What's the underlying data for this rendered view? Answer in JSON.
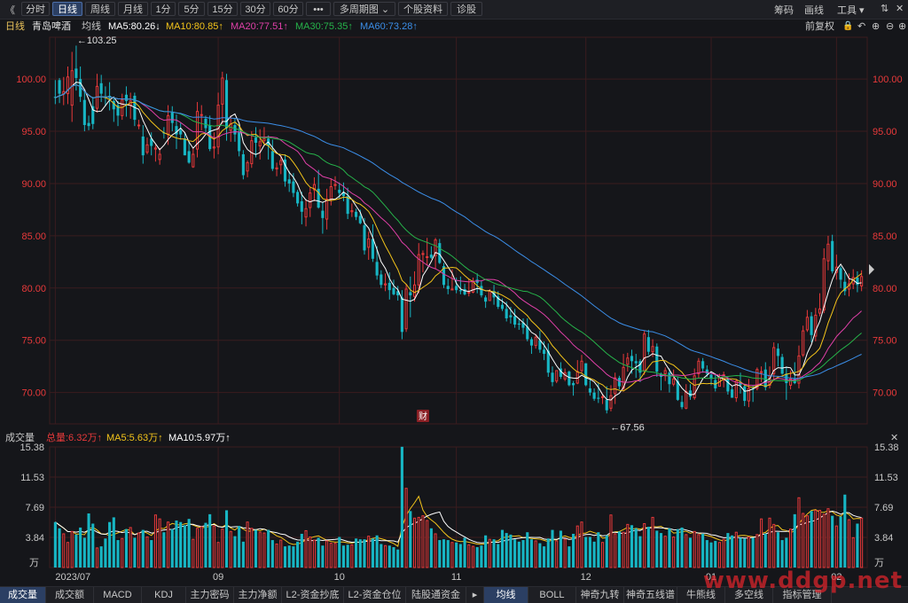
{
  "toolbar": {
    "back_icon": "double-chevron-left-icon",
    "back_glyph": "《",
    "periods": [
      "分时",
      "日线",
      "周线",
      "月线",
      "1分",
      "5分",
      "15分",
      "30分",
      "60分",
      "•••",
      "多周期图 ⌄",
      "个股资料",
      "诊股"
    ],
    "active_period": "日线",
    "right_items": [
      "筹码",
      "画线",
      "工具 ▾"
    ],
    "window_glyphs": [
      "⇅",
      "✕"
    ]
  },
  "legend": {
    "period": "日线",
    "stock": "青岛啤酒",
    "avg": "均线",
    "ma5": "MA5:80.26↓",
    "ma10": "MA10:80.85↑",
    "ma20": "MA20:77.51↑",
    "ma30": "MA30:75.35↑",
    "ma60": "MA60:73.28↑",
    "adjust": "前复权",
    "right_glyphs": [
      "🔒",
      "↶",
      "⊕",
      "⊖",
      "⊕"
    ]
  },
  "colors": {
    "up": "#e8393a",
    "down": "#17b6c4",
    "ma5": "#ffffff",
    "ma10": "#f2c31a",
    "ma20": "#e040a8",
    "ma30": "#26b34a",
    "ma60": "#3b8ee8",
    "grid": "#3a1c1f",
    "axis_text": "#e8393a"
  },
  "annotations": {
    "high": "←103.25",
    "low": "←67.56",
    "badge": "财"
  },
  "volume_legend": {
    "label": "成交量",
    "total": "总量:6.32万↑",
    "ma5": "MA5:5.63万↑",
    "ma10": "MA10:5.97万↑",
    "unit": "万"
  },
  "bottom_tabs": [
    "成交量",
    "成交额",
    "MACD",
    "KDJ",
    "主力密码",
    "主力净额",
    "L2-资金抄底",
    "L2-资金仓位",
    "陆股通资金",
    "▸",
    "均线",
    "BOLL",
    "神奇九转",
    "神奇五线谱",
    "牛熊线",
    "多空线",
    "指标管理"
  ],
  "active_bottom_tab": "成交量",
  "active_overlay_tab": "均线",
  "watermark": "www.ddgp.net",
  "chart_data": {
    "type": "candlestick",
    "title": "青岛啤酒",
    "price_ylim": [
      67.0,
      104.0
    ],
    "price_ticks": [
      70.0,
      75.0,
      80.0,
      85.0,
      90.0,
      95.0,
      100.0
    ],
    "price_tick_labels": [
      "70.00",
      "75.00",
      "80.00",
      "85.00",
      "90.00",
      "95.00",
      "100.00"
    ],
    "volume_ylim": [
      0,
      15.38
    ],
    "volume_ticks": [
      3.84,
      7.69,
      11.53,
      15.38
    ],
    "volume_tick_labels": [
      "3.84",
      "7.69",
      "11.53",
      "15.38"
    ],
    "x_labels": [
      {
        "label": "2023/07",
        "index": 0
      },
      {
        "label": "09",
        "index": 39
      },
      {
        "label": "10",
        "index": 68
      },
      {
        "label": "11",
        "index": 96
      },
      {
        "label": "12",
        "index": 127
      },
      {
        "label": "01",
        "index": 157
      },
      {
        "label": "02",
        "index": 187
      },
      {
        "label": "03",
        "index": 207
      }
    ],
    "highest": 103.25,
    "lowest": 67.56,
    "candles": [
      [
        98.3,
        98.2,
        99.9,
        97.6,
        5.8
      ],
      [
        99.9,
        98.6,
        100.1,
        97.7,
        5.0
      ],
      [
        98.6,
        98.8,
        100.2,
        97.5,
        4.3
      ],
      [
        98.6,
        100.2,
        101.2,
        97.6,
        3.2
      ],
      [
        97.5,
        100.8,
        102.6,
        95.9,
        4.6
      ],
      [
        101.0,
        100.1,
        103.2,
        98.9,
        4.2
      ],
      [
        100.0,
        98.3,
        101.2,
        97.8,
        5.1
      ],
      [
        98.0,
        95.6,
        99.0,
        95.0,
        3.8
      ],
      [
        95.8,
        95.5,
        96.5,
        95.1,
        6.9
      ],
      [
        97.4,
        95.7,
        98.3,
        95.2,
        5.6
      ],
      [
        97.2,
        99.3,
        100.5,
        96.8,
        2.5
      ],
      [
        99.6,
        98.6,
        100.4,
        97.8,
        2.7
      ],
      [
        98.3,
        98.2,
        99.3,
        97.4,
        3.7
      ],
      [
        98.4,
        98.2,
        99.7,
        97.0,
        5.8
      ],
      [
        97.9,
        97.1,
        98.3,
        95.9,
        6.4
      ],
      [
        97.5,
        96.5,
        97.9,
        95.5,
        3.5
      ],
      [
        96.5,
        98.0,
        98.6,
        96.1,
        3.7
      ],
      [
        98.5,
        97.9,
        99.3,
        96.4,
        4.9
      ],
      [
        97.5,
        97.9,
        98.7,
        96.2,
        5.1
      ],
      [
        98.4,
        96.1,
        98.7,
        95.5,
        3.8
      ],
      [
        95.6,
        95.6,
        96.1,
        95.2,
        4.4
      ],
      [
        94.5,
        92.7,
        95.6,
        91.9,
        4.8
      ],
      [
        93.0,
        93.7,
        94.4,
        92.8,
        3.9
      ],
      [
        94.3,
        93.6,
        94.9,
        92.7,
        3.5
      ],
      [
        93.3,
        93.4,
        93.7,
        92.1,
        6.7
      ],
      [
        92.3,
        92.8,
        93.4,
        91.8,
        6.2
      ],
      [
        94.9,
        94.8,
        95.4,
        94.3,
        4.5
      ],
      [
        94.7,
        96.5,
        97.5,
        93.7,
        5.8
      ],
      [
        96.8,
        95.8,
        97.4,
        95.0,
        4.9
      ],
      [
        95.5,
        94.7,
        96.6,
        93.3,
        6.0
      ],
      [
        95.1,
        94.7,
        95.8,
        94.2,
        5.8
      ],
      [
        94.3,
        92.7,
        94.9,
        92.7,
        5.4
      ],
      [
        93.1,
        92.0,
        94.1,
        91.9,
        6.2
      ],
      [
        91.6,
        92.8,
        93.4,
        91.5,
        3.6
      ],
      [
        93.3,
        96.9,
        97.8,
        92.5,
        5.0
      ],
      [
        96.6,
        96.6,
        97.5,
        95.1,
        5.2
      ],
      [
        96.2,
        95.3,
        96.5,
        94.9,
        5.7
      ],
      [
        95.6,
        93.3,
        96.5,
        93.1,
        6.8
      ],
      [
        93.4,
        93.5,
        94.9,
        92.4,
        5.3
      ],
      [
        93.5,
        97.5,
        98.7,
        92.8,
        3.2
      ],
      [
        97.6,
        100.1,
        100.7,
        95.7,
        4.9
      ],
      [
        99.9,
        95.3,
        100.5,
        94.1,
        7.3
      ],
      [
        95.1,
        95.7,
        96.5,
        94.0,
        4.6
      ],
      [
        95.6,
        94.7,
        96.2,
        94.0,
        4.0
      ],
      [
        94.9,
        93.1,
        95.7,
        92.6,
        5.3
      ],
      [
        92.8,
        90.8,
        93.2,
        90.4,
        3.3
      ],
      [
        91.2,
        92.0,
        92.2,
        90.6,
        5.8
      ],
      [
        91.9,
        94.1,
        95.0,
        91.5,
        5.0
      ],
      [
        94.4,
        93.9,
        95.4,
        92.5,
        4.8
      ],
      [
        93.6,
        94.0,
        95.2,
        92.3,
        4.5
      ],
      [
        94.1,
        94.3,
        95.4,
        93.8,
        4.4
      ],
      [
        94.3,
        93.6,
        94.6,
        92.3,
        4.8
      ],
      [
        93.1,
        91.4,
        94.2,
        91.2,
        3.5
      ],
      [
        91.4,
        91.5,
        92.0,
        90.7,
        3.0
      ],
      [
        91.8,
        92.2,
        92.7,
        90.9,
        3.5
      ],
      [
        92.3,
        90.2,
        92.8,
        89.7,
        2.7
      ],
      [
        90.4,
        90.0,
        91.2,
        89.2,
        2.8
      ],
      [
        90.2,
        89.1,
        91.0,
        88.7,
        2.7
      ],
      [
        89.2,
        88.1,
        89.4,
        87.8,
        3.3
      ],
      [
        88.3,
        87.3,
        89.2,
        86.1,
        4.3
      ],
      [
        86.8,
        87.6,
        88.5,
        85.9,
        4.7
      ],
      [
        87.7,
        89.1,
        89.6,
        86.8,
        3.9
      ],
      [
        89.4,
        89.9,
        90.6,
        88.3,
        3.5
      ],
      [
        89.5,
        87.7,
        91.3,
        87.6,
        3.8
      ],
      [
        87.4,
        86.7,
        88.2,
        85.2,
        2.8
      ],
      [
        86.6,
        88.5,
        89.5,
        85.6,
        3.4
      ],
      [
        88.5,
        89.7,
        90.5,
        87.9,
        3.1
      ],
      [
        89.9,
        89.9,
        90.7,
        89.4,
        3.1
      ],
      [
        89.4,
        89.1,
        90.1,
        88.6,
        3.9
      ],
      [
        89.1,
        88.8,
        90.1,
        88.3,
        2.8
      ],
      [
        88.8,
        87.1,
        89.6,
        86.6,
        2.9
      ],
      [
        87.3,
        87.4,
        88.1,
        86.8,
        2.9
      ],
      [
        87.3,
        86.8,
        87.6,
        86.5,
        3.7
      ],
      [
        86.9,
        86.2,
        87.5,
        86.1,
        3.6
      ],
      [
        86.0,
        83.6,
        86.7,
        83.2,
        3.6
      ],
      [
        83.9,
        84.7,
        85.4,
        82.7,
        4.0
      ],
      [
        84.7,
        82.8,
        86.1,
        82.5,
        3.7
      ],
      [
        82.5,
        81.2,
        84.0,
        80.8,
        4.1
      ],
      [
        81.3,
        80.3,
        81.7,
        80.0,
        3.0
      ],
      [
        80.3,
        80.4,
        81.4,
        79.7,
        2.8
      ],
      [
        80.5,
        79.8,
        81.5,
        78.9,
        2.8
      ],
      [
        80.0,
        79.4,
        80.8,
        79.3,
        2.6
      ],
      [
        79.7,
        79.3,
        80.2,
        78.8,
        2.3
      ],
      [
        79.1,
        75.8,
        79.8,
        75.1,
        15.4
      ],
      [
        76.1,
        79.9,
        80.4,
        75.8,
        10.1
      ],
      [
        79.6,
        79.3,
        81.1,
        77.2,
        7.2
      ],
      [
        79.2,
        80.3,
        81.6,
        78.7,
        6.3
      ],
      [
        80.3,
        83.2,
        84.3,
        79.5,
        6.4
      ],
      [
        83.3,
        83.3,
        83.6,
        81.5,
        6.6
      ],
      [
        83.0,
        83.0,
        84.8,
        82.2,
        6.0
      ],
      [
        83.2,
        82.9,
        84.0,
        82.8,
        5.0
      ],
      [
        83.1,
        84.6,
        84.8,
        81.8,
        4.3
      ],
      [
        84.3,
        82.4,
        84.7,
        82.3,
        3.5
      ],
      [
        82.1,
        80.3,
        82.4,
        80.0,
        3.6
      ],
      [
        80.2,
        79.9,
        80.9,
        79.4,
        3.5
      ],
      [
        79.9,
        79.9,
        81.8,
        79.8,
        3.2
      ],
      [
        80.2,
        79.8,
        81.0,
        79.5,
        3.2
      ],
      [
        79.8,
        79.7,
        81.1,
        79.4,
        3.0
      ],
      [
        79.9,
        79.4,
        80.4,
        79.3,
        3.8
      ],
      [
        79.6,
        79.6,
        80.9,
        79.2,
        2.9
      ],
      [
        79.6,
        80.6,
        81.0,
        79.5,
        2.7
      ],
      [
        80.8,
        80.5,
        81.4,
        79.5,
        2.6
      ],
      [
        80.2,
        79.3,
        80.7,
        79.1,
        2.8
      ],
      [
        79.1,
        78.7,
        79.3,
        78.1,
        4.1
      ],
      [
        78.8,
        79.7,
        79.9,
        78.8,
        3.6
      ],
      [
        79.7,
        79.1,
        80.3,
        78.4,
        3.6
      ],
      [
        79.2,
        78.2,
        79.7,
        78.0,
        3.0
      ],
      [
        78.4,
        78.0,
        79.0,
        77.8,
        4.8
      ],
      [
        78.0,
        77.1,
        78.7,
        76.8,
        4.4
      ],
      [
        77.4,
        77.2,
        78.2,
        76.6,
        4.2
      ],
      [
        77.3,
        76.5,
        78.0,
        76.2,
        3.6
      ],
      [
        76.6,
        76.5,
        77.1,
        76.0,
        3.3
      ],
      [
        76.7,
        76.2,
        77.1,
        75.6,
        3.5
      ],
      [
        76.3,
        75.1,
        77.1,
        74.9,
        4.5
      ],
      [
        75.1,
        74.5,
        75.3,
        73.7,
        3.6
      ],
      [
        74.5,
        75.3,
        75.6,
        74.2,
        3.4
      ],
      [
        75.0,
        74.1,
        75.9,
        73.8,
        3.1
      ],
      [
        74.1,
        73.7,
        74.9,
        73.1,
        2.7
      ],
      [
        74.0,
        71.9,
        74.7,
        71.5,
        3.7
      ],
      [
        71.9,
        71.0,
        72.5,
        70.6,
        4.8
      ],
      [
        71.1,
        72.1,
        72.1,
        70.9,
        3.4
      ],
      [
        72.3,
        71.5,
        72.9,
        71.3,
        4.7
      ],
      [
        71.3,
        71.9,
        72.3,
        71.1,
        3.6
      ],
      [
        72.0,
        70.7,
        72.1,
        70.6,
        2.7
      ],
      [
        70.9,
        70.7,
        71.1,
        69.7,
        4.3
      ],
      [
        70.9,
        72.0,
        73.1,
        70.8,
        5.3
      ],
      [
        72.1,
        73.0,
        73.6,
        71.9,
        5.8
      ],
      [
        72.8,
        70.7,
        72.8,
        70.6,
        3.9
      ],
      [
        70.4,
        70.0,
        71.4,
        69.7,
        3.9
      ],
      [
        70.0,
        69.4,
        70.4,
        69.2,
        3.3
      ],
      [
        69.5,
        69.4,
        70.9,
        69.0,
        4.5
      ],
      [
        69.6,
        69.6,
        69.8,
        68.9,
        3.2
      ],
      [
        69.3,
        68.3,
        70.6,
        68.0,
        4.1
      ],
      [
        68.5,
        69.7,
        70.7,
        68.2,
        6.7
      ],
      [
        69.9,
        71.4,
        71.9,
        68.9,
        4.3
      ],
      [
        71.4,
        70.6,
        71.6,
        70.3,
        4.6
      ],
      [
        70.4,
        72.4,
        73.7,
        70.1,
        4.5
      ],
      [
        72.7,
        73.3,
        73.8,
        72.0,
        5.5
      ],
      [
        73.5,
        73.0,
        74.1,
        71.8,
        5.4
      ],
      [
        73.0,
        72.8,
        73.7,
        71.4,
        5.0
      ],
      [
        73.0,
        71.9,
        73.2,
        71.0,
        4.0
      ],
      [
        72.1,
        75.6,
        75.9,
        71.7,
        5.6
      ],
      [
        75.3,
        73.9,
        76.0,
        73.6,
        5.2
      ],
      [
        73.9,
        74.4,
        75.1,
        73.4,
        6.4
      ],
      [
        74.4,
        72.0,
        74.7,
        71.5,
        4.7
      ],
      [
        71.8,
        71.5,
        71.9,
        70.2,
        4.4
      ],
      [
        71.8,
        72.1,
        72.4,
        71.1,
        4.0
      ],
      [
        71.9,
        70.8,
        72.3,
        70.0,
        5.0
      ],
      [
        70.8,
        71.3,
        72.2,
        70.6,
        3.9
      ],
      [
        71.1,
        69.3,
        71.5,
        69.2,
        4.9
      ],
      [
        69.1,
        68.6,
        69.7,
        68.4,
        5.1
      ],
      [
        68.5,
        70.1,
        70.8,
        68.4,
        4.2
      ],
      [
        70.2,
        69.6,
        70.8,
        69.3,
        3.8
      ],
      [
        69.5,
        71.6,
        72.3,
        69.3,
        4.6
      ],
      [
        71.8,
        73.0,
        73.3,
        71.4,
        4.2
      ],
      [
        73.0,
        72.3,
        73.3,
        71.9,
        4.3
      ],
      [
        72.2,
        71.8,
        72.6,
        71.5,
        3.5
      ],
      [
        71.7,
        71.3,
        72.0,
        70.7,
        3.2
      ],
      [
        71.2,
        70.4,
        71.8,
        70.1,
        3.4
      ],
      [
        70.6,
        71.4,
        71.8,
        70.6,
        3.2
      ],
      [
        71.2,
        71.7,
        72.0,
        70.5,
        3.6
      ],
      [
        71.3,
        70.1,
        71.5,
        69.8,
        4.4
      ],
      [
        70.3,
        69.5,
        70.6,
        69.5,
        4.1
      ],
      [
        69.5,
        71.1,
        71.3,
        69.1,
        4.5
      ],
      [
        71.0,
        70.7,
        71.9,
        69.9,
        3.8
      ],
      [
        70.6,
        69.2,
        70.7,
        68.7,
        3.7
      ],
      [
        69.2,
        70.4,
        71.3,
        68.6,
        3.9
      ],
      [
        70.4,
        70.3,
        70.7,
        69.1,
        3.8
      ],
      [
        70.4,
        72.2,
        72.4,
        70.2,
        4.2
      ],
      [
        71.9,
        72.0,
        72.5,
        71.0,
        6.2
      ],
      [
        72.2,
        70.5,
        72.9,
        70.2,
        4.3
      ],
      [
        70.7,
        71.6,
        72.5,
        70.4,
        6.3
      ],
      [
        71.8,
        74.3,
        74.8,
        71.2,
        5.5
      ],
      [
        74.2,
        73.5,
        74.7,
        72.5,
        4.5
      ],
      [
        73.4,
        71.8,
        73.7,
        71.7,
        3.5
      ],
      [
        71.8,
        70.9,
        72.5,
        69.3,
        3.8
      ],
      [
        70.7,
        71.3,
        72.1,
        70.3,
        4.9
      ],
      [
        71.3,
        70.9,
        72.9,
        70.8,
        6.8
      ],
      [
        70.9,
        73.5,
        74.5,
        70.4,
        8.9
      ],
      [
        73.6,
        75.9,
        76.4,
        73.4,
        6.9
      ],
      [
        76.0,
        77.2,
        77.9,
        75.8,
        6.6
      ],
      [
        77.3,
        75.5,
        77.7,
        74.8,
        7.2
      ],
      [
        75.4,
        77.4,
        78.1,
        74.9,
        7.3
      ],
      [
        77.6,
        78.0,
        79.5,
        77.3,
        7.3
      ],
      [
        77.9,
        82.8,
        83.8,
        77.6,
        6.8
      ],
      [
        82.6,
        84.2,
        85.0,
        81.7,
        7.5
      ],
      [
        84.5,
        81.6,
        85.1,
        81.4,
        6.6
      ],
      [
        81.5,
        82.0,
        83.2,
        80.8,
        5.3
      ],
      [
        81.9,
        80.8,
        82.1,
        80.0,
        6.5
      ],
      [
        80.6,
        79.7,
        81.5,
        79.3,
        9.3
      ],
      [
        79.9,
        80.4,
        81.4,
        79.2,
        6.1
      ],
      [
        80.4,
        81.0,
        81.8,
        79.9,
        3.8
      ],
      [
        81.0,
        80.3,
        81.6,
        79.6,
        5.6
      ],
      [
        80.2,
        81.1,
        81.7,
        79.7,
        6.3
      ]
    ],
    "ma_series": [
      {
        "name": "MA5",
        "period": 5,
        "color": "#ffffff"
      },
      {
        "name": "MA10",
        "period": 10,
        "color": "#f2c31a"
      },
      {
        "name": "MA20",
        "period": 20,
        "color": "#e040a8"
      },
      {
        "name": "MA30",
        "period": 30,
        "color": "#26b34a"
      },
      {
        "name": "MA60",
        "period": 60,
        "color": "#3b8ee8"
      }
    ]
  }
}
